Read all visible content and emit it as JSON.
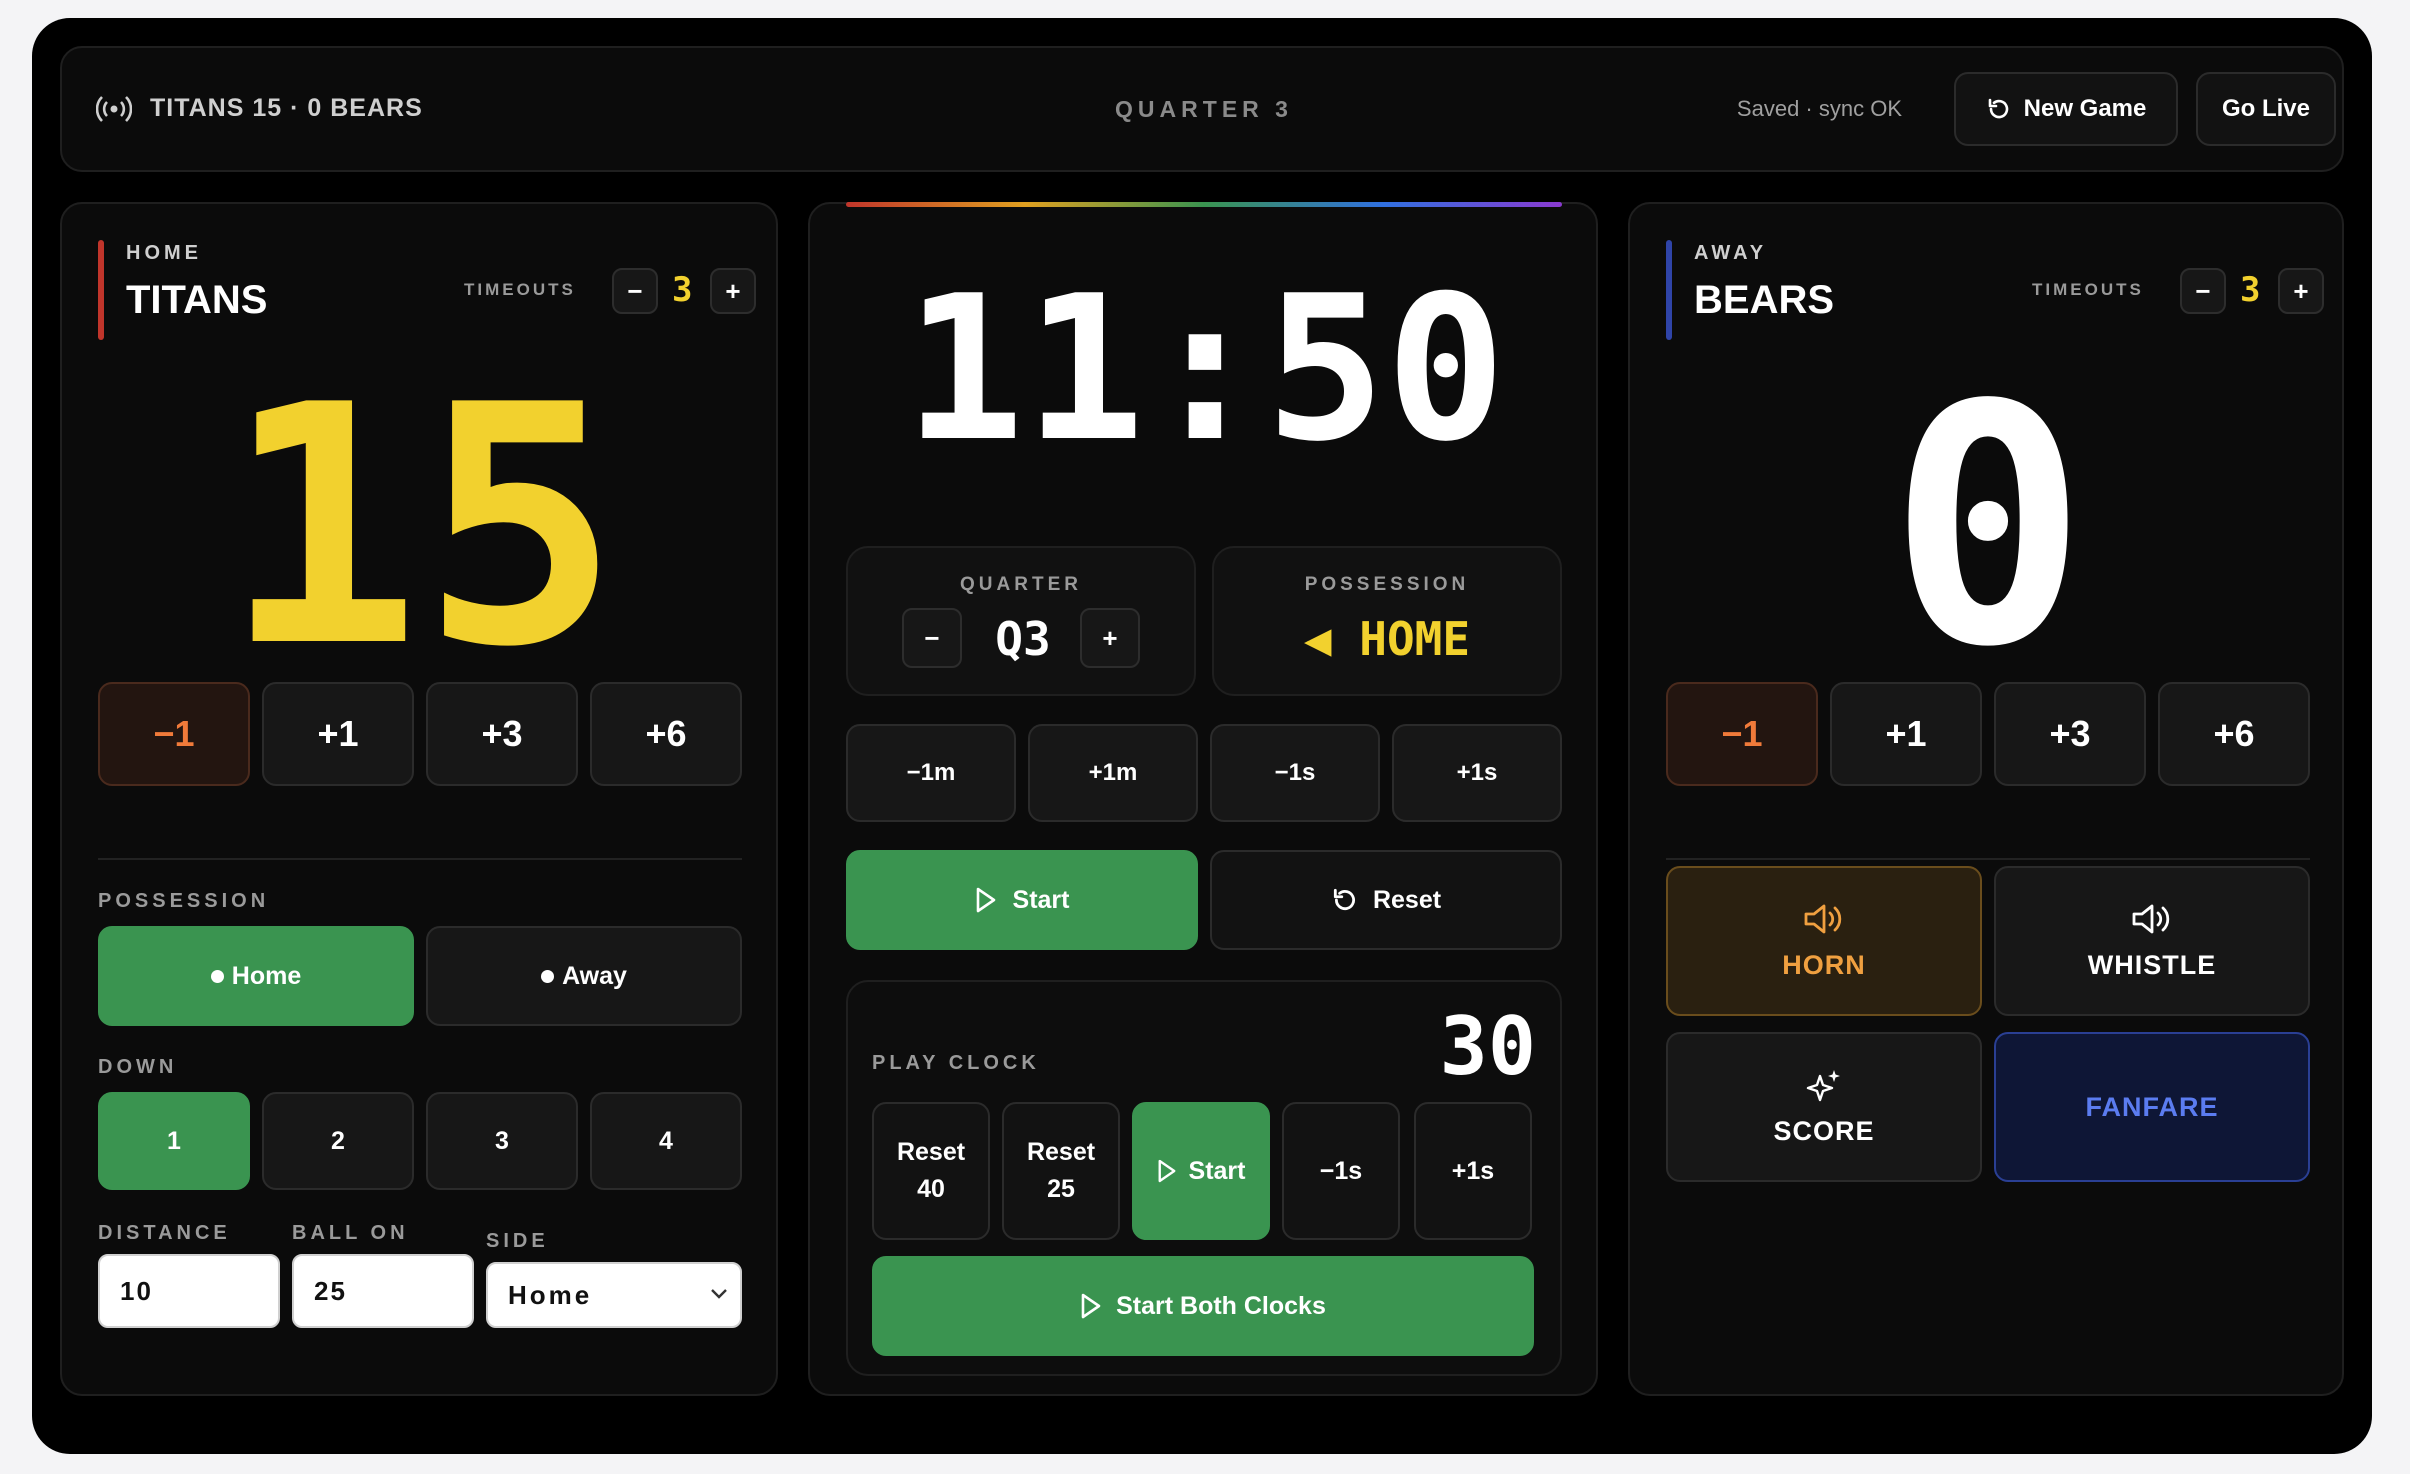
{
  "header": {
    "score_summary": "TITANS 15 · 0 BEARS",
    "quarter_label": "QUARTER 3",
    "status": "Saved · sync OK",
    "new_game_label": "New Game",
    "go_live_label": "Go Live"
  },
  "home": {
    "side_label": "HOME",
    "team": "TITANS",
    "timeouts_label": "TIMEOUTS",
    "timeouts": "3",
    "score": "15",
    "accent": "#c0352b",
    "score_color": "#f2d12e",
    "adjust": [
      "−1",
      "+1",
      "+3",
      "+6"
    ]
  },
  "away": {
    "side_label": "AWAY",
    "team": "BEARS",
    "timeouts_label": "TIMEOUTS",
    "timeouts": "3",
    "score": "0",
    "accent": "#2f44a8",
    "adjust": [
      "−1",
      "+1",
      "+3",
      "+6"
    ]
  },
  "game_controls": {
    "possession_label": "POSSESSION",
    "possession_home": "Home",
    "possession_away": "Away",
    "down_label": "DOWN",
    "downs": [
      "1",
      "2",
      "3",
      "4"
    ],
    "selected_down": "1",
    "distance_label": "DISTANCE",
    "distance_value": "10",
    "ball_on_label": "BALL ON",
    "ball_on_value": "25",
    "side_label": "SIDE",
    "side_value": "Home"
  },
  "clock": {
    "time": "11:50",
    "quarter_label": "QUARTER",
    "quarter_value": "Q3",
    "possession_label": "POSSESSION",
    "possession_value": "◀ HOME",
    "adjust": [
      "−1m",
      "+1m",
      "−1s",
      "+1s"
    ],
    "start_label": "Start",
    "reset_label": "Reset"
  },
  "play_clock": {
    "label": "PLAY CLOCK",
    "value": "30",
    "reset40_top": "Reset",
    "reset40_bottom": "40",
    "reset25_top": "Reset",
    "reset25_bottom": "25",
    "start_label": "Start",
    "minus_label": "−1s",
    "plus_label": "+1s",
    "start_both_label": "Start Both Clocks"
  },
  "sounds": {
    "horn": "HORN",
    "whistle": "WHISTLE",
    "score": "SCORE",
    "fanfare": "FANFARE"
  },
  "colors": {
    "green": "#3a9450",
    "yellow": "#f2d12e",
    "orange": "#f07a3a",
    "horn": "#f0a040",
    "fanfare": "#5b7cf0"
  }
}
